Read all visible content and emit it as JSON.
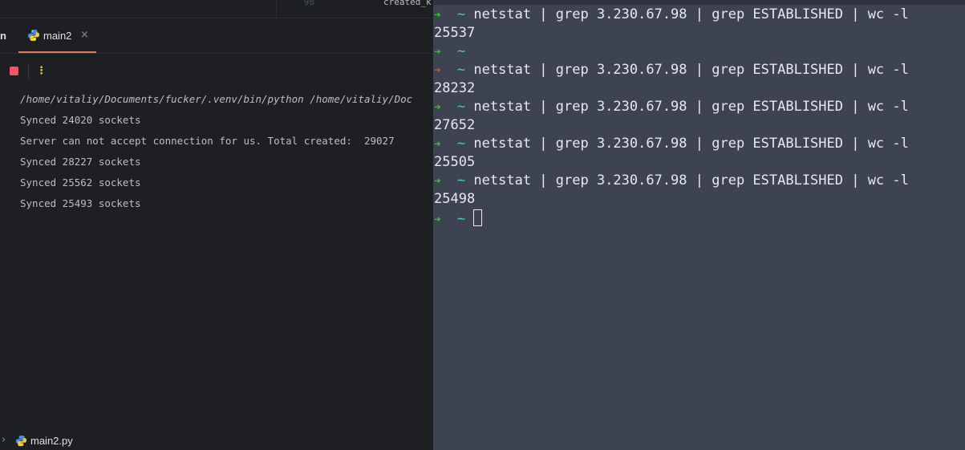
{
  "editor": {
    "gutter_number": "98",
    "code_fragment": "created_k"
  },
  "tabs": {
    "prev_label": "n",
    "active": {
      "label": "main2",
      "close": "×",
      "icon": "python-icon"
    }
  },
  "toolbar": {
    "stop_icon": "stop-icon",
    "more_label": "⋮",
    "stop_color": "#f0566a",
    "more_color": "#f2c55c"
  },
  "console": {
    "lines": [
      "/home/vitaliy/Documents/fucker/.venv/bin/python /home/vitaliy/Doc",
      "Synced 24020 sockets",
      "Server can not accept connection for us. Total created:  29027",
      "Synced 28227 sockets",
      "Synced 25562 sockets",
      "Synced 25493 sockets"
    ]
  },
  "statusbar": {
    "chevron": "›",
    "file": "main2.py",
    "icon": "python-icon"
  },
  "terminal": {
    "prompt_arrow": "➜",
    "prompt_tilde": "~",
    "command": "netstat | grep 3.230.67.98 | grep ESTABLISHED | wc -l",
    "outputs": [
      "25537",
      "28232",
      "27652",
      "25505",
      "25498"
    ],
    "colors": {
      "ok": "#37c337",
      "error": "#e0443a",
      "dir": "#4fc1d9",
      "background": "#3e4351"
    }
  }
}
